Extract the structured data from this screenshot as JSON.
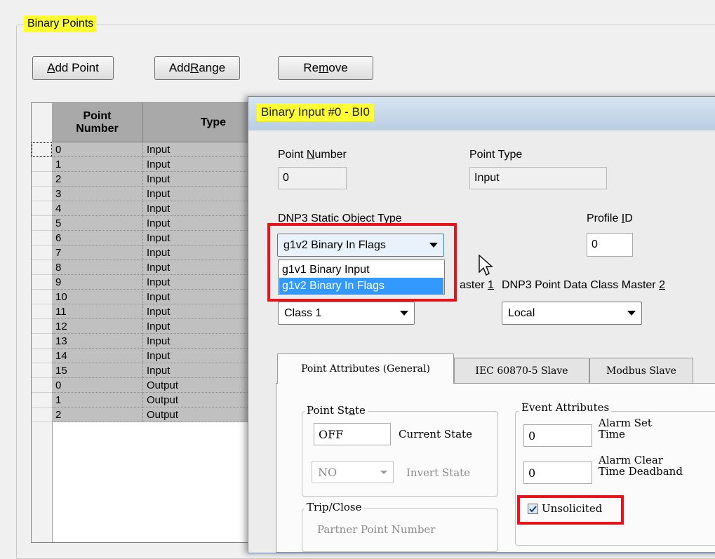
{
  "binary_points": {
    "group_title": "Binary Points",
    "buttons": {
      "add_point": {
        "pre": "",
        "u": "A",
        "post": "dd Point"
      },
      "add_range": {
        "pre": "Add ",
        "u": "R",
        "post": "ange"
      },
      "remove": {
        "pre": "Re",
        "u": "m",
        "post": "ove"
      }
    },
    "table": {
      "headers": {
        "point_number": "Point\nNumber",
        "type": "Type"
      },
      "rows": [
        {
          "num": "0",
          "type": "Input"
        },
        {
          "num": "1",
          "type": "Input"
        },
        {
          "num": "2",
          "type": "Input"
        },
        {
          "num": "3",
          "type": "Input"
        },
        {
          "num": "4",
          "type": "Input"
        },
        {
          "num": "5",
          "type": "Input"
        },
        {
          "num": "6",
          "type": "Input"
        },
        {
          "num": "7",
          "type": "Input"
        },
        {
          "num": "8",
          "type": "Input"
        },
        {
          "num": "9",
          "type": "Input"
        },
        {
          "num": "10",
          "type": "Input"
        },
        {
          "num": "11",
          "type": "Input"
        },
        {
          "num": "12",
          "type": "Input"
        },
        {
          "num": "13",
          "type": "Input"
        },
        {
          "num": "14",
          "type": "Input"
        },
        {
          "num": "15",
          "type": "Input"
        },
        {
          "num": "0",
          "type": "Output"
        },
        {
          "num": "1",
          "type": "Output"
        },
        {
          "num": "2",
          "type": "Output"
        }
      ]
    }
  },
  "dialog": {
    "title": "Binary Input #0 - BI0",
    "point_number": {
      "label_pre": "Point ",
      "label_u": "N",
      "label_post": "umber",
      "value": "0"
    },
    "point_type": {
      "label": "Point Type",
      "value": "Input"
    },
    "static_object_type": {
      "label": "DNP3 Static Object Type",
      "selected": "g1v2 Binary In Flags",
      "options": [
        "g1v1 Binary Input",
        "g1v2 Binary In Flags"
      ]
    },
    "profile_id": {
      "label_pre": "Profile ",
      "label_u": "I",
      "label_post": "D",
      "value": "0"
    },
    "class_master_1": {
      "label_visible": "aster ",
      "label_u": "1",
      "value": "Class 1"
    },
    "class_master_2": {
      "label": "DNP3 Point Data Class Master ",
      "label_u": "2",
      "value": "Local"
    },
    "tabs": [
      "Point Attributes (General)",
      "IEC 60870-5 Slave",
      "Modbus Slave"
    ],
    "point_state": {
      "legend_pre": "Point St",
      "legend_u": "a",
      "legend_post": "te",
      "current_state_value": "OFF",
      "current_state_label": "Current State",
      "invert_state_value": "NO",
      "invert_state_label": "Invert State"
    },
    "event_attributes": {
      "legend": "Event Attributes",
      "alarm_set_value": "0",
      "alarm_set_label": "Alarm Set\nTime",
      "alarm_clear_value": "0",
      "alarm_clear_label": "Alarm Clear\nTime Deadband",
      "unsolicited_label": "Unsolicited",
      "unsolicited_checked": true
    },
    "trip_close": {
      "legend": "Trip/Close",
      "partner_label": "Partner Point Number"
    }
  },
  "colors": {
    "highlight_yellow": "#ffff36",
    "highlight_red": "#e8141c",
    "selection_blue": "#3399ff"
  }
}
